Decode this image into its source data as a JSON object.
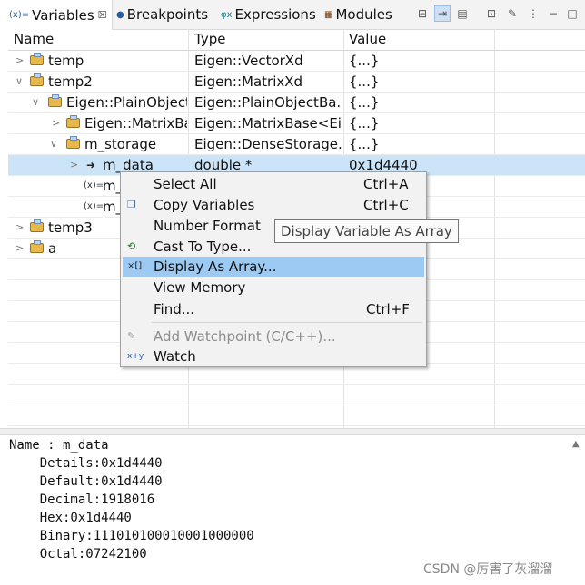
{
  "tabs": [
    {
      "label": "Variables",
      "icon": "(x)=",
      "close": "☒"
    },
    {
      "label": "Breakpoints",
      "icon": "●"
    },
    {
      "label": "Expressions",
      "icon": "φx"
    },
    {
      "label": "Modules",
      "icon": "▦"
    }
  ],
  "columns": {
    "name": "Name",
    "type": "Type",
    "value": "Value"
  },
  "rows": [
    {
      "name": "temp",
      "type": "Eigen::VectorXd",
      "value": "{...}"
    },
    {
      "name": "temp2",
      "type": "Eigen::MatrixXd",
      "value": "{...}"
    },
    {
      "name": "Eigen::PlainObjectBase",
      "type": "Eigen::PlainObjectBa...",
      "value": "{...}"
    },
    {
      "name": "Eigen::MatrixBase",
      "type": "Eigen::MatrixBase<Ei...",
      "value": "{...}"
    },
    {
      "name": "m_storage",
      "type": "Eigen::DenseStorage...",
      "value": "{...}"
    },
    {
      "name": "m_data",
      "type": "double *",
      "value": "0x1d4440"
    },
    {
      "name": "m_",
      "type": "",
      "value": ""
    },
    {
      "name": "m_",
      "type": "",
      "value": ""
    },
    {
      "name": "temp3",
      "type": "",
      "value": ""
    },
    {
      "name": "a",
      "type": "",
      "value": ""
    }
  ],
  "menu": {
    "select_all": {
      "label": "Select All",
      "shortcut": "Ctrl+A"
    },
    "copy_variables": {
      "label": "Copy Variables",
      "shortcut": "Ctrl+C"
    },
    "number_format": {
      "label": "Number Format"
    },
    "cast_to_type": {
      "label": "Cast To Type..."
    },
    "display_as_array": {
      "label": "Display As Array...",
      "icon": "×[]"
    },
    "view_memory": {
      "label": "View Memory"
    },
    "find": {
      "label": "Find...",
      "shortcut": "Ctrl+F"
    },
    "add_watchpoint": {
      "label": "Add Watchpoint (C/C++)..."
    },
    "watch": {
      "label": "Watch",
      "icon": "x+y"
    }
  },
  "tooltip": "Display Variable As Array",
  "details": {
    "name": "Name : m_data",
    "lines": [
      "    Details:0x1d4440",
      "    Default:0x1d4440",
      "    Decimal:1918016",
      "    Hex:0x1d4440",
      "    Binary:111010100010001000000",
      "    Octal:07242100"
    ]
  },
  "watermark": "CSDN @厉害了灰溜溜",
  "colors": {
    "selection": "#cce4f7",
    "menu_highlight": "#9ccaf2",
    "accent": "#2a5db0"
  }
}
